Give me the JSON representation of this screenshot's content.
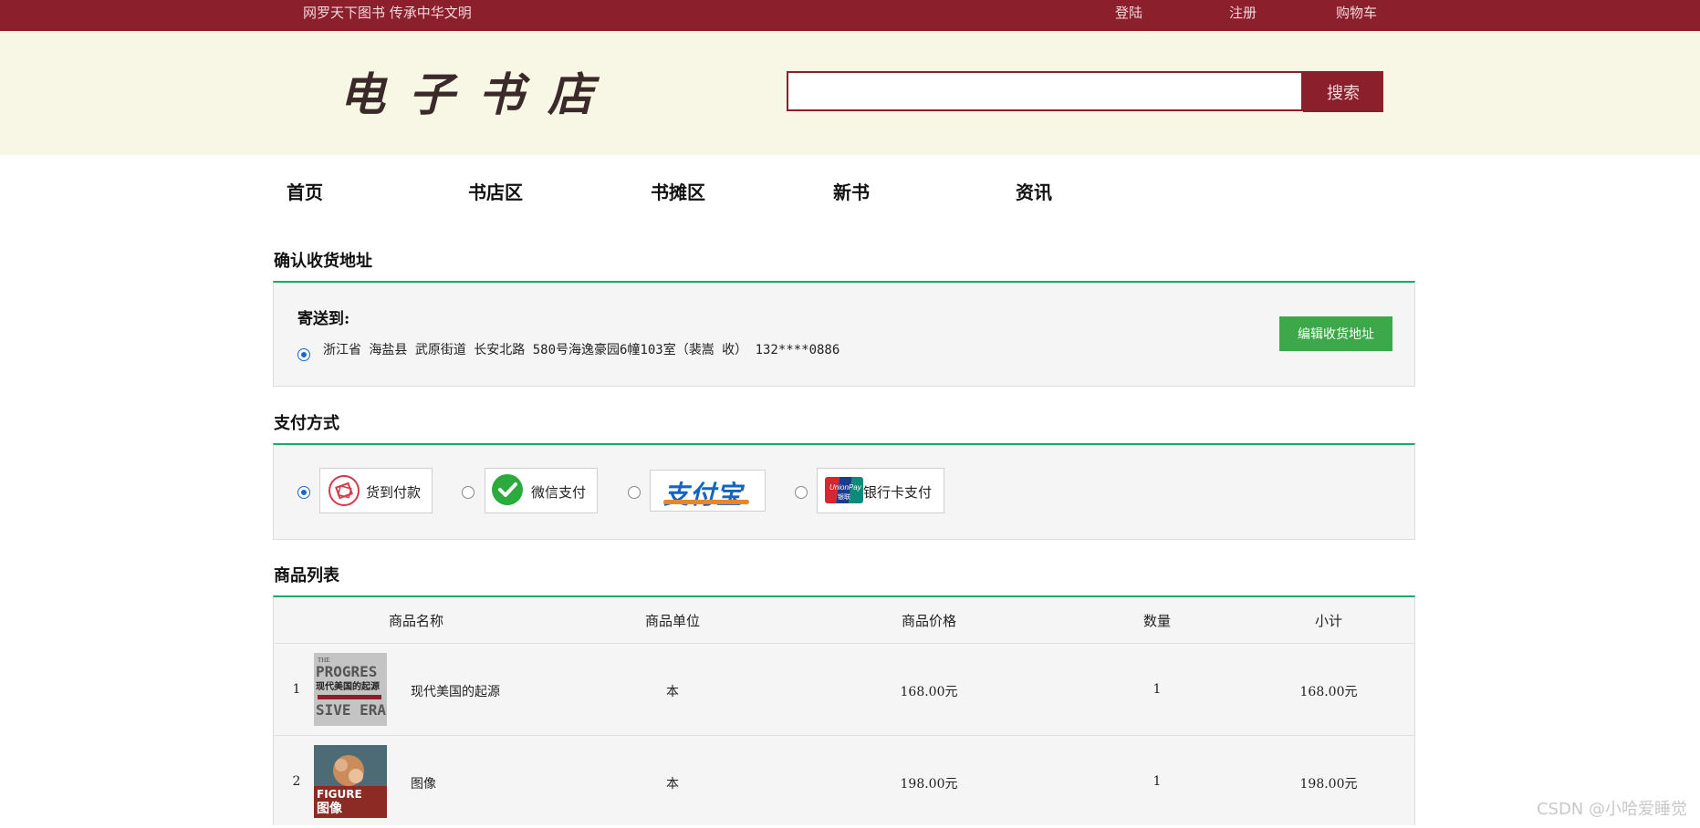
{
  "topbar": {
    "slogan": "网罗天下图书  传承中华文明",
    "login": "登陆",
    "register": "注册",
    "cart": "购物车"
  },
  "header": {
    "logo_text": "电子书店",
    "search_value": "",
    "search_button": "搜索"
  },
  "nav": {
    "items": [
      "首页",
      "书店区",
      "书摊区",
      "新书",
      "资讯"
    ]
  },
  "address": {
    "section_title": "确认收货地址",
    "ship_to_label": "寄送到:",
    "address_line": "浙江省 海盐县 武原街道 长安北路 580号海逸豪园6幢103室（裴嵩 收） 132****0886",
    "selected": true,
    "edit_button": "编辑收货地址"
  },
  "payment": {
    "section_title": "支付方式",
    "options": [
      {
        "label": "货到付款",
        "icon": "cash-on-delivery-icon",
        "selected": true
      },
      {
        "label": "微信支付",
        "icon": "wechat-pay-icon",
        "selected": false
      },
      {
        "label": "支付宝",
        "icon": "alipay-logo",
        "selected": false
      },
      {
        "label": "银行卡支付",
        "icon": "unionpay-icon",
        "selected": false
      }
    ]
  },
  "products": {
    "section_title": "商品列表",
    "columns": [
      "商品名称",
      "商品单位",
      "商品价格",
      "数量",
      "小计"
    ],
    "rows": [
      {
        "index": "1",
        "name": "现代美国的起源",
        "unit": "本",
        "price": "168.00元",
        "quantity": "1",
        "subtotal": "168.00元",
        "cover_text_1": "THE",
        "cover_text_2": "PROGRES",
        "cover_text_3": "现代美国的起源",
        "cover_text_4": "SIVE ERA"
      },
      {
        "index": "2",
        "name": "图像",
        "unit": "本",
        "price": "198.00元",
        "quantity": "1",
        "subtotal": "198.00元",
        "cover_text_1": "FIGURE",
        "cover_text_2": "图像"
      }
    ]
  },
  "watermark": "CSDN @小哈爱睡觉",
  "colors": {
    "brand": "#8b1f2c",
    "header_bg": "#f8f7e6",
    "accent_line": "#1aa86b",
    "edit_button": "#3ca84a"
  }
}
